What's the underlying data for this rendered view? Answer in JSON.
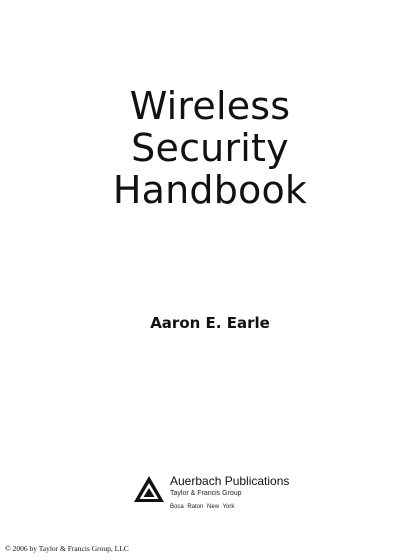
{
  "book": {
    "title_lines": [
      "Wireless",
      "Security",
      "Handbook"
    ],
    "author": "Aaron E. Earle"
  },
  "publisher": {
    "name": "Auerbach Publications",
    "group": "Taylor & Francis Group",
    "cities": "Boca Raton   New York",
    "logo_icon": "triangle-publisher-logo-icon"
  },
  "footer": {
    "copyright": "© 2006 by Taylor & Francis Group, LLC"
  }
}
